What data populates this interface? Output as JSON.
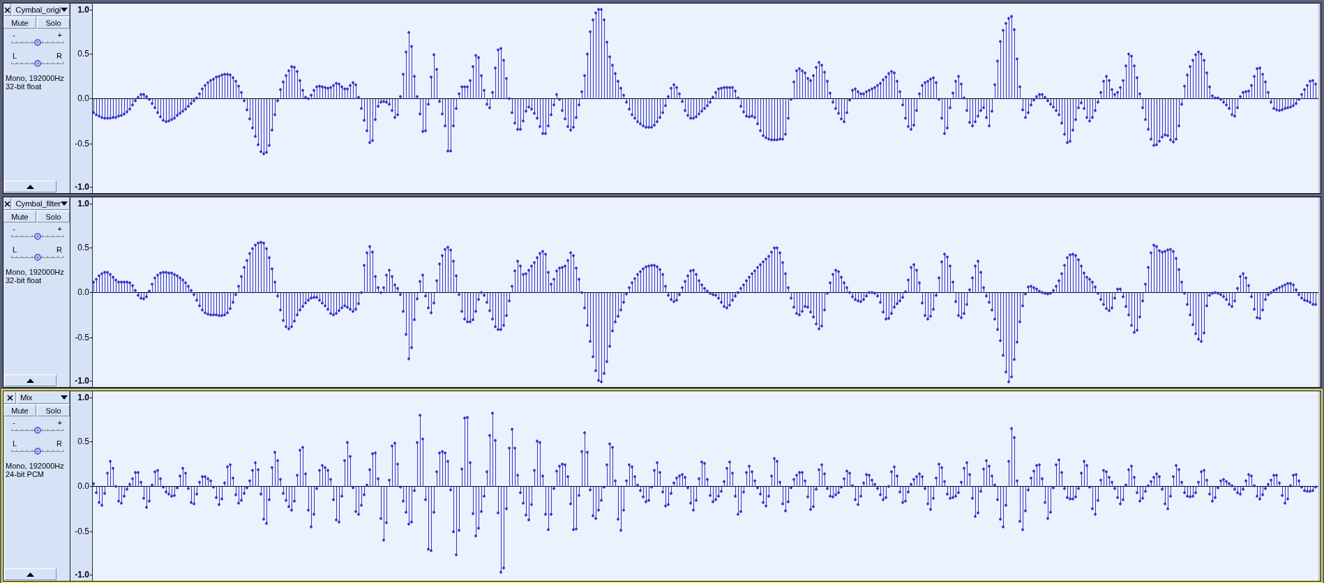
{
  "tracks": [
    {
      "name": "Cymbal_origi",
      "focused": false,
      "mute": {
        "label": "Mute",
        "on": false
      },
      "solo": {
        "label": "Solo",
        "on": false
      },
      "gain": {
        "minus": "-",
        "plus": "+",
        "level": 0.5
      },
      "pan": {
        "left": "L",
        "right": "R",
        "level": 0.5
      },
      "info": [
        "Mono, 192000Hz",
        "32-bit float"
      ],
      "axis_labels": [
        "1.0",
        "0.5",
        "0.0",
        "-0.5",
        "-1.0"
      ]
    },
    {
      "name": "Cymbal_filter",
      "focused": false,
      "mute": {
        "label": "Mute",
        "on": false
      },
      "solo": {
        "label": "Solo",
        "on": false
      },
      "gain": {
        "minus": "-",
        "plus": "+",
        "level": 0.5
      },
      "pan": {
        "left": "L",
        "right": "R",
        "level": 0.5
      },
      "info": [
        "Mono, 192000Hz",
        "32-bit float"
      ],
      "axis_labels": [
        "1.0",
        "0.5",
        "0.0",
        "-0.5",
        "-1.0"
      ]
    },
    {
      "name": "Mix",
      "focused": true,
      "mute": {
        "label": "Mute",
        "on": false
      },
      "solo": {
        "label": "Solo",
        "on": false
      },
      "gain": {
        "minus": "-",
        "plus": "+",
        "level": 0.5
      },
      "pan": {
        "left": "L",
        "right": "R",
        "level": 0.5
      },
      "info": [
        "Mono, 192000Hz",
        "24-bit PCM"
      ],
      "axis_labels": [
        "1.0",
        "0.5",
        "0.0",
        "-0.5",
        "-1.0"
      ]
    }
  ]
}
